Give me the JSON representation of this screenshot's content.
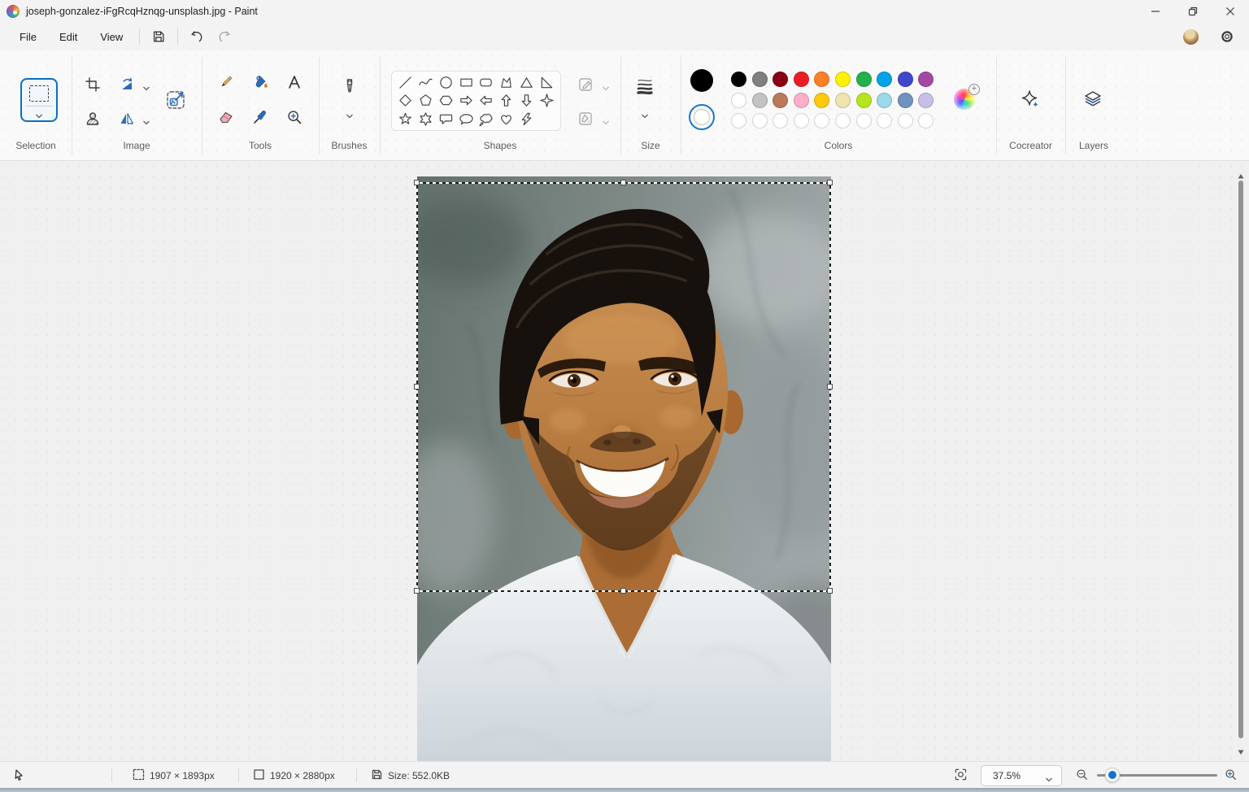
{
  "window": {
    "title": "joseph-gonzalez-iFgRcqHznqg-unsplash.jpg - Paint"
  },
  "menu": {
    "file": "File",
    "edit": "Edit",
    "view": "View"
  },
  "ribbon": {
    "selection": {
      "label": "Selection"
    },
    "image": {
      "label": "Image"
    },
    "tools": {
      "label": "Tools"
    },
    "brushes": {
      "label": "Brushes"
    },
    "shapes": {
      "label": "Shapes",
      "items": [
        "line",
        "curve",
        "ellipse",
        "rectangle",
        "rounded-rectangle",
        "polygon",
        "triangle",
        "right-triangle",
        "diamond",
        "pentagon",
        "hexagon",
        "arrow-right",
        "arrow-left",
        "arrow-up",
        "arrow-down",
        "star-4",
        "star-5",
        "star-6",
        "speech-rounded",
        "speech-oval",
        "thought-bubble",
        "heart",
        "lightning"
      ]
    },
    "size": {
      "label": "Size"
    },
    "colors": {
      "label": "Colors",
      "color1": "#000000",
      "color2": "#ffffff",
      "accent": "#0b6fc2",
      "palette": [
        [
          "#000000",
          "#7f7f7f",
          "#880015",
          "#ed1c24",
          "#ff7f27",
          "#fff200",
          "#22b14c",
          "#00a2e8",
          "#3f48cc",
          "#a349a4"
        ],
        [
          "#ffffff",
          "#c3c3c3",
          "#b97a57",
          "#ffaec9",
          "#ffc90e",
          "#efe4b0",
          "#b5e61d",
          "#99d9ea",
          "#7092be",
          "#c8bfe7"
        ],
        [
          "",
          "",
          "",
          "",
          "",
          "",
          "",
          "",
          "",
          ""
        ]
      ]
    },
    "cocreator": {
      "label": "Cocreator"
    },
    "layers": {
      "label": "Layers"
    }
  },
  "statusbar": {
    "selection_size": "1907 × 1893px",
    "canvas_size": "1920 × 2880px",
    "file_size": "Size: 552.0KB",
    "zoom_value": "37.5%"
  },
  "icons": {
    "titlebar": [
      "paint-logo",
      "minimize",
      "restore",
      "close"
    ],
    "menubar": [
      "save",
      "undo",
      "redo",
      "account-avatar",
      "settings-gear"
    ],
    "statusbar": [
      "cursor",
      "selection-dims",
      "canvas-dims",
      "file-save",
      "fit-to-screen",
      "zoom-out",
      "zoom-in"
    ]
  }
}
